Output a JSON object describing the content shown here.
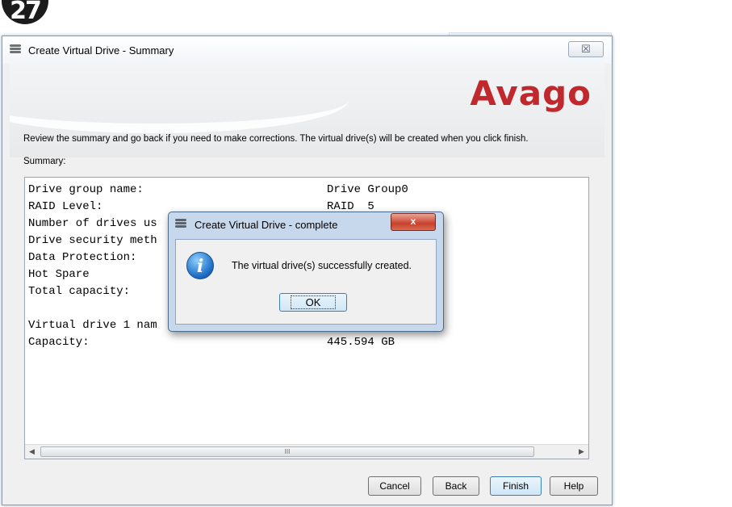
{
  "step_badge": "27",
  "window": {
    "title": "Create Virtual Drive - Summary",
    "close_glyph": "☒",
    "logo": "Avago",
    "instruction": "Review the summary and go back if you need to make corrections. The virtual drive(s) will be created when you click finish.",
    "summary_label": "Summary:"
  },
  "summary": {
    "rows": [
      {
        "label": "Drive group name:",
        "value": "Drive Group0"
      },
      {
        "label": "RAID Level:",
        "value": "RAID  5"
      },
      {
        "label": "Number of drives us",
        "value": ""
      },
      {
        "label": "Drive security meth",
        "value": ""
      },
      {
        "label": "Data Protection:",
        "value": ""
      },
      {
        "label": "Hot Spare",
        "value": ""
      },
      {
        "label": "Total capacity:",
        "value": ""
      },
      {
        "label": "",
        "value": ""
      },
      {
        "label": "Virtual drive 1 nam",
        "value": ""
      },
      {
        "label": "Capacity:",
        "value": "445.594 GB"
      }
    ]
  },
  "scrollbar": {
    "left_arrow": "◀",
    "right_arrow": "▶",
    "thumb_grip": "III"
  },
  "buttons": {
    "cancel": "Cancel",
    "back": "Back",
    "finish": "Finish",
    "help": "Help"
  },
  "dialog": {
    "title": "Create Virtual Drive - complete",
    "close_glyph": "x",
    "info_glyph": "i",
    "message": "The virtual drive(s) successfully created.",
    "ok": "OK"
  },
  "colors": {
    "logo_red": "#c0282d",
    "dialog_frame": "#c7d8ec",
    "dialog_close": "#c8402b"
  }
}
